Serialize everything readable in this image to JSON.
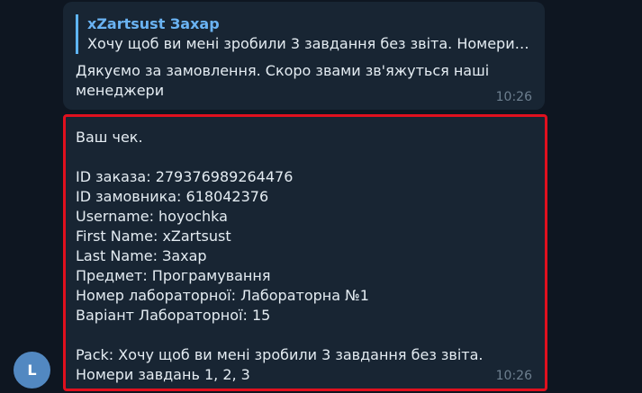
{
  "messages": [
    {
      "reply": {
        "author": "xZartsust Захар",
        "text": "Хочу щоб ви мені зробили 3 завдання без звіта. Номери завд..."
      },
      "text": "Дякуємо за замовлення. Скоро звами зв'яжуться наші менеджери",
      "time": "10:26"
    },
    {
      "title": "Ваш чек.",
      "lines": [
        "ID заказа: 279376989264476",
        "ID замовника: 618042376",
        "Username: hoyochka",
        "First Name: xZartsust",
        "Last Name: Захар",
        "Предмет: Програмування",
        "Номер лабораторної: Лабораторна №1",
        "Варіант Лабораторної: 15"
      ],
      "pack": "Pack: Хочу щоб ви мені зробили 3 завдання без звіта. Номери завдань 1, 2, 3",
      "time": "10:26"
    }
  ],
  "avatar": {
    "letter": "L",
    "color": "#5288c1"
  },
  "colors": {
    "background": "#0e1621",
    "bubble": "#182533",
    "accent": "#6ab3f3",
    "highlight_border": "#e0101e"
  }
}
